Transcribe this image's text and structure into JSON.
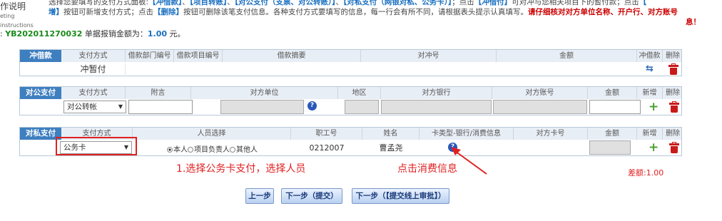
{
  "sidebar": {
    "title_line1": "作说明",
    "title_line2": "eting instructions"
  },
  "instructions": {
    "line1_a": "选择您要填写的支付方式面板:",
    "line1_b": "【冲借款】",
    "line1_c": "、",
    "line1_d": "【项目转账】",
    "line1_e": "、",
    "line1_f": "【对公支付（支票、对公转账）】",
    "line1_g": "、",
    "line1_h": "【对私支付（网银对私、公务卡）】",
    "line1_i": "；点击",
    "line1_j": "【冲借付】",
    "line1_k": "可对冲与您相关项目下的暂付款；点击",
    "line1_l": "【",
    "line2_a": "增】",
    "line2_b": "按钮可新增支付方式；点击",
    "line2_c": "【删除】",
    "line2_d": "按钮可删除该笔支付信息。各种支付方式要填写的信息，每一行会有所不同，请根据表头提示认真填写。",
    "line2_e": "请仔细核对对方单位名称、开户行、对方账号",
    "line3": "息！"
  },
  "summary": {
    "prefix": ": ",
    "reimb_no": "YB202011270032",
    "label": "单据报销金额为：",
    "amount": "1.00",
    "unit": "元。"
  },
  "offset_panel": {
    "tag": "冲借款",
    "headers": [
      "支付方式",
      "借款部门编号",
      "借款项目编号",
      "借款摘要",
      "对冲号",
      "金额",
      "冲借款",
      "删除"
    ],
    "row": {
      "method": "冲暂付"
    }
  },
  "public_panel": {
    "tag": "对公支付",
    "headers": [
      "支付方式",
      "附言",
      "对方单位",
      "地区",
      "对方银行",
      "对方账号",
      "金额",
      "新增",
      "删除"
    ],
    "row": {
      "method": "对公转帐"
    }
  },
  "private_panel": {
    "tag": "对私支付",
    "headers": [
      "支付方式",
      "人员选择",
      "职工号",
      "姓名",
      "卡类型-银行/消费信息",
      "对方卡号",
      "金额",
      "新增",
      "删除"
    ],
    "row": {
      "method": "公务卡",
      "person_options": [
        "本人",
        "项目负责人",
        "其他人"
      ],
      "selected_person": "本人",
      "employee_no": "0212007",
      "name": "曹孟尧"
    }
  },
  "annotations": {
    "step1": "1.选择公务卡支付，选择人员",
    "step2": "点击消费信息"
  },
  "difference": {
    "label": "差额:",
    "value": "1.00"
  },
  "buttons": {
    "prev": "上一步",
    "next_submit": "下一步（提交）",
    "next_approve": "下一步（【提交线上审批】）"
  },
  "colors": {
    "accent": "#3e7fc0",
    "warning": "#e02020",
    "add": "#4aa032",
    "delete": "#c81a1a"
  }
}
